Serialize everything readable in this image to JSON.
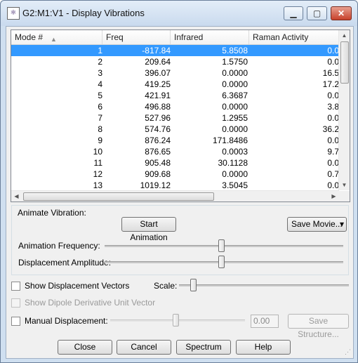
{
  "window": {
    "app_icon": "molecule-icon",
    "title": "G2:M1:V1 - Display Vibrations",
    "minimize": "▁",
    "maximize": "▢",
    "close": "✕"
  },
  "table": {
    "columns": [
      "Mode #",
      "Freq",
      "Infrared",
      "Raman Activity"
    ],
    "sort_indicator": "▲",
    "rows": [
      [
        "1",
        "-817.84",
        "5.8508",
        "0.0"
      ],
      [
        "2",
        "209.64",
        "1.5750",
        "0.0"
      ],
      [
        "3",
        "396.07",
        "0.0000",
        "16.5"
      ],
      [
        "4",
        "419.25",
        "0.0000",
        "17.2"
      ],
      [
        "5",
        "421.91",
        "6.3687",
        "0.0"
      ],
      [
        "6",
        "496.88",
        "0.0000",
        "3.8"
      ],
      [
        "7",
        "527.96",
        "1.2955",
        "0.0"
      ],
      [
        "8",
        "574.76",
        "0.0000",
        "36.2"
      ],
      [
        "9",
        "876.24",
        "171.8486",
        "0.0"
      ],
      [
        "10",
        "876.65",
        "0.0003",
        "9.7"
      ],
      [
        "11",
        "905.48",
        "30.1128",
        "0.0"
      ],
      [
        "12",
        "909.68",
        "0.0000",
        "0.7"
      ],
      [
        "13",
        "1019.12",
        "3.5045",
        "0.0"
      ]
    ],
    "selected_row_index": 0
  },
  "animate": {
    "group_label": "Animate Vibration:",
    "start_button": "Start Animation",
    "save_movie_button": "Save Movie...",
    "save_movie_arrow": "▾",
    "frequency_label": "Animation Frequency:",
    "amplitude_label": "Displacement Amplitude:"
  },
  "options": {
    "show_vectors_label": "Show Displacement Vectors",
    "scale_label": "Scale:",
    "show_dipole_label": "Show Dipole Derivative Unit Vector",
    "manual_disp_label": "Manual Displacement:",
    "manual_value": "0.00",
    "save_structure_button": "Save Structure..."
  },
  "buttons": {
    "close": "Close",
    "cancel": "Cancel",
    "spectrum": "Spectrum",
    "help": "Help"
  }
}
